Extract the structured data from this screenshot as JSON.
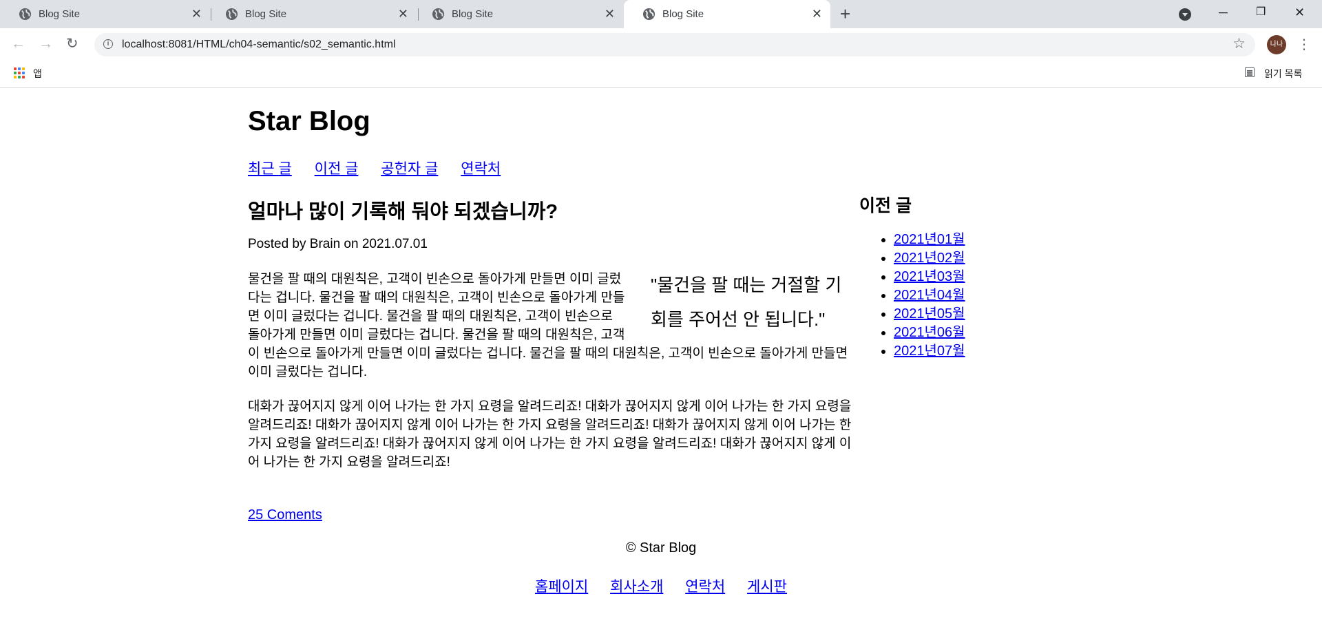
{
  "browser": {
    "tabs": [
      {
        "title": "Blog Site",
        "active": false
      },
      {
        "title": "Blog Site",
        "active": false
      },
      {
        "title": "Blog Site",
        "active": false
      },
      {
        "title": "Blog Site",
        "active": true
      }
    ],
    "tab_close_glyph": "✕",
    "new_tab_glyph": "+",
    "url": "localhost:8081/HTML/ch04-semantic/s02_semantic.html",
    "profile_initials": "나나",
    "bookmarks": {
      "apps_label": "앱",
      "reading_list_label": "읽기 목록"
    },
    "colors": {
      "tab_strip": "#dee1e6",
      "omnibox": "#f1f3f4",
      "avatar": "#6d3b2a"
    }
  },
  "site": {
    "title": "Star Blog",
    "nav": [
      "최근 글",
      "이전 글",
      "공헌자 글",
      "연락처"
    ]
  },
  "post": {
    "title": "얼마나 많이 기록해 둬야 되겠습니까?",
    "meta": "Posted by Brain on 2021.07.01",
    "quote": "\"물건을 팔 때는 거절할 기회를 주어선 안 됩니다.\"",
    "paragraph1": "물건을 팔 때의 대원칙은, 고객이 빈손으로 돌아가게 만들면 이미 글렀다는 겁니다. 물건을 팔 때의 대원칙은, 고객이 빈손으로 돌아가게 만들면 이미 글렀다는 겁니다. 물건을 팔 때의 대원칙은, 고객이 빈손으로 돌아가게 만들면 이미 글렀다는 겁니다. 물건을 팔 때의 대원칙은, 고객이 빈손으로 돌아가게 만들면 이미 글렀다는 겁니다. 물건을 팔 때의 대원칙은, 고객이 빈손으로 돌아가게 만들면 이미 글렀다는 겁니다.",
    "paragraph2": "대화가 끊어지지 않게 이어 나가는 한 가지 요령을 알려드리죠! 대화가 끊어지지 않게 이어 나가는 한 가지 요령을 알려드리죠! 대화가 끊어지지 않게 이어 나가는 한 가지 요령을 알려드리죠! 대화가 끊어지지 않게 이어 나가는 한 가지 요령을 알려드리죠! 대화가 끊어지지 않게 이어 나가는 한 가지 요령을 알려드리죠! 대화가 끊어지지 않게 이어 나가는 한 가지 요령을 알려드리죠!",
    "comments_link": "25 Coments"
  },
  "sidebar": {
    "heading": "이전 글",
    "archive": [
      "2021년01월",
      "2021년02월",
      "2021년03월",
      "2021년04월",
      "2021년05월",
      "2021년06월",
      "2021년07월"
    ]
  },
  "footer": {
    "copyright": "© Star Blog",
    "nav": [
      "홈페이지",
      "회사소개",
      "연락처",
      "게시판"
    ]
  },
  "theme": {
    "link_color": "#0000ee",
    "text_color": "#000000"
  }
}
